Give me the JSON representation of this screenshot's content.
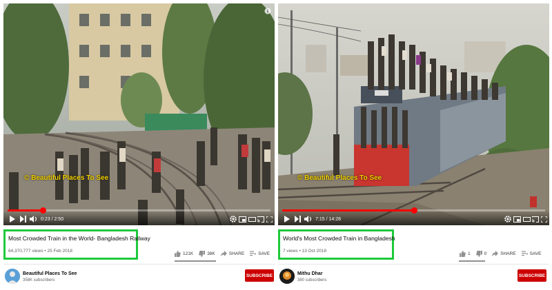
{
  "left": {
    "watermark": "© Beautiful Places To See",
    "time": "0:23 / 2:50",
    "progress": 0.135,
    "title": "Most Crowded Train in the World- Bangladesh Railway",
    "meta": "64,370,777 views • 25 Feb 2018",
    "likes": "121K",
    "dislikes": "38K",
    "share_label": "SHARE",
    "save_label": "SAVE",
    "channel_name": "Beautiful Places To See",
    "subscribers": "358K subscribers",
    "subscribe_label": "SUBSCRIBE"
  },
  "right": {
    "watermark": "© Beautiful Places To See",
    "time": "7:15 / 14:28",
    "progress": 0.5,
    "title": "World's Most Crowded Train in Bangladesh",
    "meta": "7 views • 13 Oct 2018",
    "likes": "1",
    "dislikes": "0",
    "share_label": "SHARE",
    "save_label": "SAVE",
    "channel_name": "Mithu Dhar",
    "subscribers": "380 subscribers",
    "subscribe_label": "SUBSCRIBE"
  },
  "colors": {
    "highlight_border": "#1ec93b",
    "subscribe_bg": "#cc0000",
    "progress": "#ff0000"
  },
  "icons": [
    "play-icon",
    "next-icon",
    "volume-icon",
    "settings-icon",
    "miniplayer-icon",
    "theater-icon",
    "cast-icon",
    "fullscreen-icon",
    "like-icon",
    "dislike-icon",
    "share-icon",
    "save-icon",
    "info-icon"
  ]
}
